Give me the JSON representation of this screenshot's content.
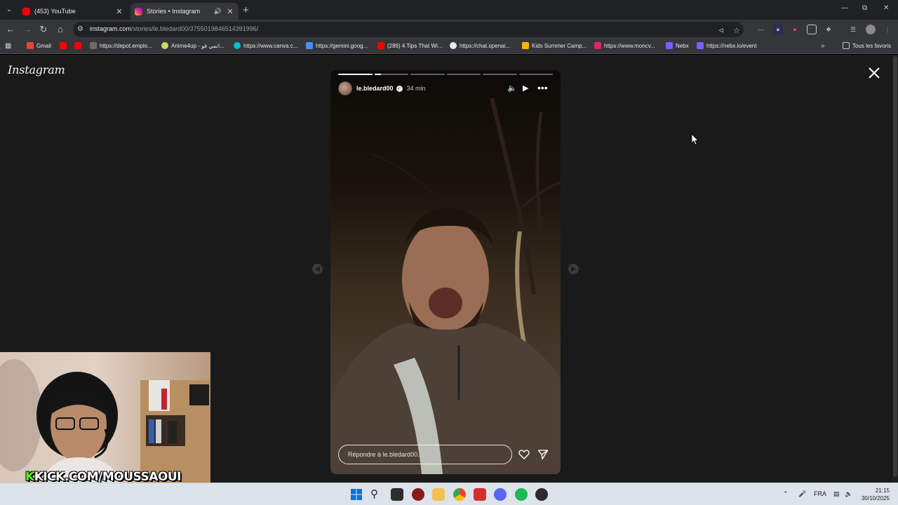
{
  "browser": {
    "tabs": [
      {
        "title": "(453) YouTube",
        "active": false,
        "favicon": "youtube-icon"
      },
      {
        "title": "Stories • Instagram",
        "active": true,
        "favicon": "instagram-icon"
      }
    ],
    "address": {
      "host": "instagram.com",
      "path": "/stories/le.bledard00/3755019846514391996/"
    },
    "bookmarks": [
      {
        "label": "Gmail",
        "icon": "gmail-icon"
      },
      {
        "label": "",
        "icon": "youtube-icon"
      },
      {
        "label": "",
        "icon": "youtube-icon"
      },
      {
        "label": "https://depot.emplo...",
        "icon": "globe-icon"
      },
      {
        "label": "Anime4up - انمي فو...",
        "icon": "globe-icon"
      },
      {
        "label": "https://www.canva.c...",
        "icon": "canva-icon"
      },
      {
        "label": "https://gemini.goog...",
        "icon": "gemini-icon"
      },
      {
        "label": "(286) 4 Tips That Wi...",
        "icon": "youtube-icon"
      },
      {
        "label": "https://chat.openai...",
        "icon": "openai-icon"
      },
      {
        "label": "Kids Summer Camp...",
        "icon": "bookmark-icon"
      },
      {
        "label": "https://www.moncv...",
        "icon": "p-icon"
      },
      {
        "label": "Nebx",
        "icon": "nebx-icon"
      },
      {
        "label": "https://nebx.io/event",
        "icon": "nebx-icon"
      }
    ],
    "all_bookmarks": "Tous les favoris",
    "colors": {
      "tabstrip": "#202124",
      "toolbar": "#35363a",
      "accent": "#8ab4f8"
    }
  },
  "instagram": {
    "logo": "Instagram",
    "story": {
      "username": "le.bledard00",
      "time": "34 min",
      "segments": 6,
      "current_segment": 2,
      "current_progress": 0.2,
      "reply_placeholder": "Répondre à le.bledard00..."
    }
  },
  "overlay": {
    "kick_k": "K",
    "kick_text": "KICK.COM/MOUSSAOUI"
  },
  "taskbar": {
    "language": "FRA",
    "time": "21:15",
    "date": "30/10/2025"
  }
}
